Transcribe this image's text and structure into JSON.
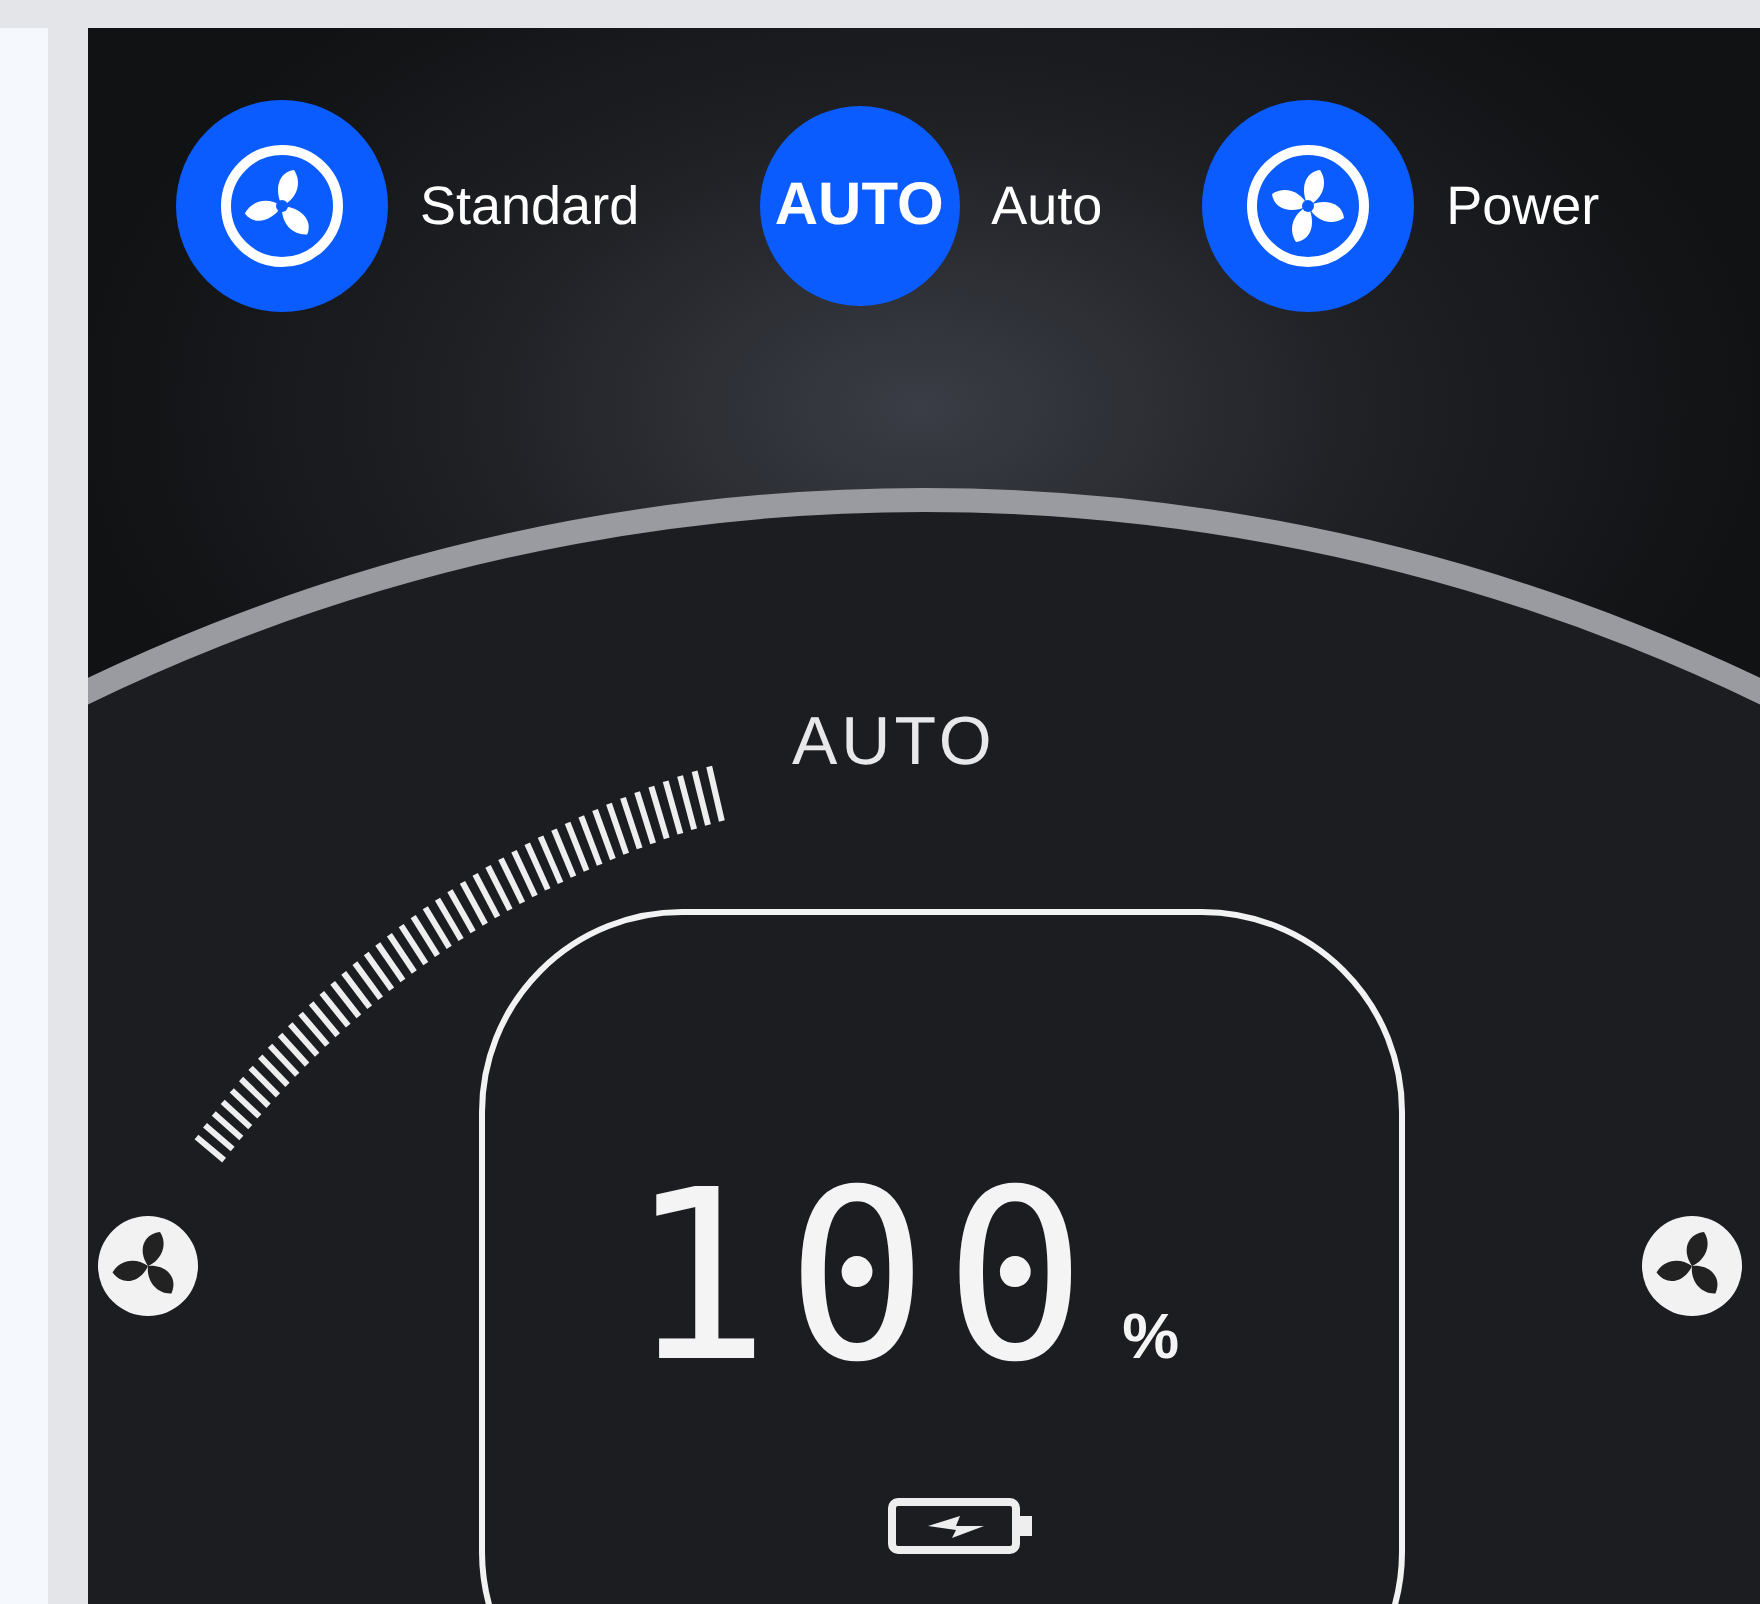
{
  "modes": [
    {
      "kind": "fan3",
      "label": "Standard"
    },
    {
      "kind": "badge",
      "badge": "AUTO",
      "label": "Auto"
    },
    {
      "kind": "fan4",
      "label": "Power"
    }
  ],
  "device": {
    "mode_label": "AUTO",
    "reading": "100",
    "unit": "%"
  }
}
